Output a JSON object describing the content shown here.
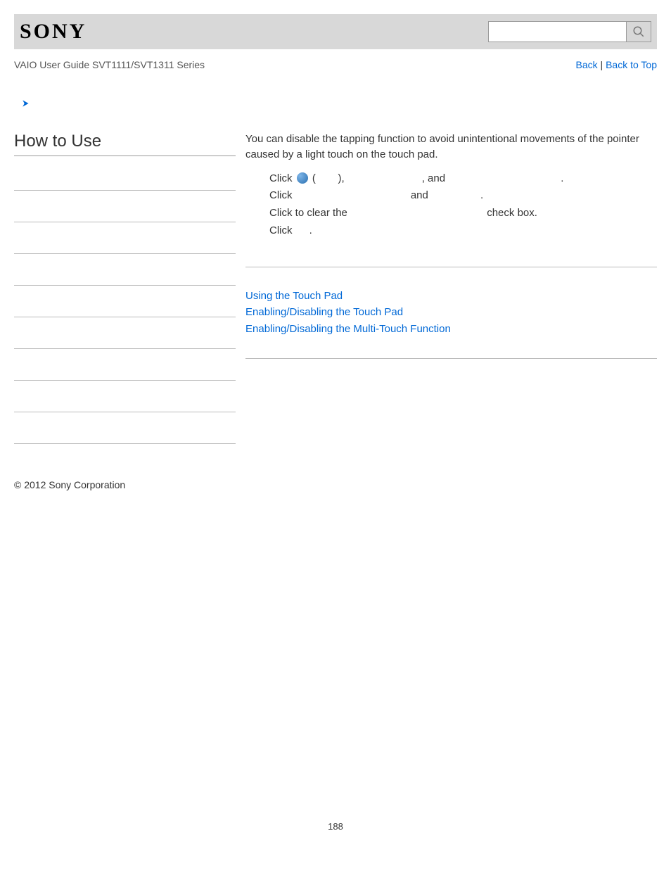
{
  "header": {
    "logo_text": "SONY",
    "search_placeholder": ""
  },
  "subheader": {
    "guide_title": "VAIO User Guide SVT1111/SVT1311 Series",
    "back_label": "Back",
    "separator": " | ",
    "back_to_top_label": "Back to Top"
  },
  "left": {
    "heading": "How to Use"
  },
  "content": {
    "intro": "You can disable the tapping function to avoid unintentional movements of the pointer caused by a light touch on the touch pad.",
    "step1_prefix": "Click ",
    "step1_paren_open": " (",
    "step1_paren_close": "),",
    "step1_and": ", and ",
    "step1_period": ".",
    "step2_prefix": "Click ",
    "step2_and": " and ",
    "step2_period": ".",
    "step3_prefix": "Click to clear the ",
    "step3_suffix": " check box.",
    "step4_prefix": "Click ",
    "step4_period": "."
  },
  "related": {
    "link1": "Using the Touch Pad",
    "link2": "Enabling/Disabling the Touch Pad",
    "link3": "Enabling/Disabling the Multi-Touch Function"
  },
  "footer": {
    "copyright": "© 2012 Sony Corporation",
    "page_number": "188"
  }
}
